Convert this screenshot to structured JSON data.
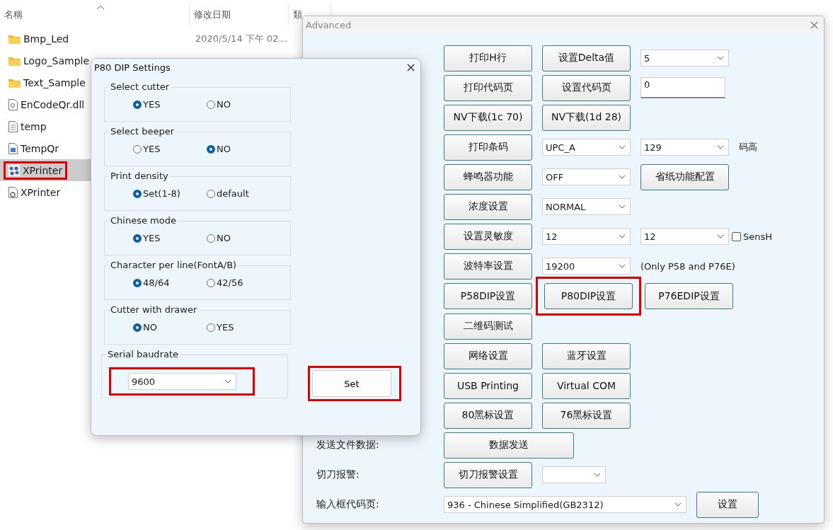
{
  "explorer": {
    "columns": [
      {
        "label": "名稱",
        "sorted": true
      },
      {
        "label": "修改日期",
        "sorted": false
      },
      {
        "label": "類",
        "sorted": false
      }
    ],
    "rows": [
      {
        "name": "Bmp_Led",
        "kind": "folder",
        "date": "2020/5/14 下午 02...",
        "selected": false,
        "highlighted": false
      },
      {
        "name": "Logo_Sample",
        "kind": "folder",
        "selected": false,
        "highlighted": false
      },
      {
        "name": "Text_Sample",
        "kind": "folder",
        "selected": false,
        "highlighted": false
      },
      {
        "name": "EnCodeQr.dll",
        "kind": "library",
        "selected": false,
        "highlighted": false
      },
      {
        "name": "temp",
        "kind": "text",
        "selected": false,
        "highlighted": false
      },
      {
        "name": "TempQr",
        "kind": "image",
        "selected": false,
        "highlighted": false
      },
      {
        "name": "XPrinter",
        "kind": "app",
        "selected": true,
        "highlighted": true
      },
      {
        "name": "XPrinter",
        "kind": "config",
        "selected": false,
        "highlighted": false
      }
    ]
  },
  "advanced": {
    "title": "Advanced",
    "rows": [
      {
        "cells": [
          {
            "kind": "button",
            "text": "打印H行"
          },
          {
            "kind": "button",
            "text": "设置Delta值"
          },
          {
            "kind": "select",
            "text": "5"
          }
        ]
      },
      {
        "cells": [
          {
            "kind": "button",
            "text": "打印代码页"
          },
          {
            "kind": "button",
            "text": "设置代码页"
          },
          {
            "kind": "input",
            "text": "0"
          }
        ]
      },
      {
        "cells": [
          {
            "kind": "button",
            "text": "NV下载(1c 70)"
          },
          {
            "kind": "button",
            "text": "NV下载(1d 28)"
          }
        ]
      },
      {
        "cells": [
          {
            "kind": "button",
            "text": "打印条码"
          },
          {
            "kind": "select",
            "text": "UPC_A"
          },
          {
            "kind": "select",
            "text": "129"
          },
          {
            "kind": "text",
            "text": "码高"
          }
        ]
      },
      {
        "cells": [
          {
            "kind": "button",
            "text": "蜂鸣器功能"
          },
          {
            "kind": "select",
            "text": "OFF"
          },
          {
            "kind": "button",
            "text": "省纸功能配置"
          }
        ]
      },
      {
        "cells": [
          {
            "kind": "button",
            "text": "浓度设置"
          },
          {
            "kind": "select",
            "text": "NORMAL"
          }
        ]
      },
      {
        "cells": [
          {
            "kind": "button",
            "text": "设置灵敏度"
          },
          {
            "kind": "select",
            "text": "12"
          },
          {
            "kind": "select",
            "text": "12"
          },
          {
            "kind": "checkbox",
            "text": "SensH",
            "checked": false
          }
        ]
      },
      {
        "cells": [
          {
            "kind": "button",
            "text": "波特率设置"
          },
          {
            "kind": "select",
            "text": "19200"
          },
          {
            "kind": "text",
            "text": "(Only P58 and P76E)"
          }
        ]
      },
      {
        "cells": [
          {
            "kind": "button",
            "text": "P58DIP设置"
          },
          {
            "kind": "button",
            "text": "P80DIP设置",
            "highlighted": true
          },
          {
            "kind": "button",
            "text": "P76EDIP设置"
          }
        ]
      },
      {
        "cells": [
          {
            "kind": "button",
            "text": "二维码测试"
          }
        ]
      },
      {
        "cells": [
          {
            "kind": "button",
            "text": "网络设置"
          },
          {
            "kind": "button",
            "text": "蓝牙设置"
          }
        ]
      },
      {
        "cells": [
          {
            "kind": "button",
            "text": "USB Printing"
          },
          {
            "kind": "button",
            "text": "Virtual COM"
          }
        ]
      },
      {
        "cells": [
          {
            "kind": "button",
            "text": "80黑标设置"
          },
          {
            "kind": "button",
            "text": "76黑标设置"
          }
        ]
      },
      {
        "label": "发送文件数据:",
        "cells": [
          {
            "kind": "wide_button",
            "text": "数据发送"
          }
        ]
      },
      {
        "label": "切刀报警:",
        "cells": [
          {
            "kind": "button",
            "text": "切刀报警设置"
          },
          {
            "kind": "small_select"
          }
        ]
      },
      {
        "label": "输入框代码页:",
        "cells": [
          {
            "kind": "wide_select",
            "text": "936 - Chinese Simplified(GB2312)"
          },
          {
            "kind": "short_button",
            "text": "设置"
          }
        ]
      }
    ]
  },
  "dip": {
    "title": "P80 DIP Settings",
    "groups": [
      {
        "title": "Select cutter",
        "options": [
          {
            "label": "YES",
            "selected": true
          },
          {
            "label": "NO",
            "selected": false
          }
        ]
      },
      {
        "title": "Select beeper",
        "options": [
          {
            "label": "YES",
            "selected": false
          },
          {
            "label": "NO",
            "selected": true
          }
        ]
      },
      {
        "title": "Print density",
        "options": [
          {
            "label": "Set(1-8)",
            "selected": true
          },
          {
            "label": "default",
            "selected": false
          }
        ]
      },
      {
        "title": "Chinese mode",
        "options": [
          {
            "label": "YES",
            "selected": true
          },
          {
            "label": "NO",
            "selected": false
          }
        ]
      },
      {
        "title": "Character per line(FontA/B)",
        "options": [
          {
            "label": "48/64",
            "selected": true
          },
          {
            "label": "42/56",
            "selected": false
          }
        ]
      },
      {
        "title": "Cutter with drawer",
        "options": [
          {
            "label": "NO",
            "selected": true
          },
          {
            "label": "YES",
            "selected": false
          }
        ]
      }
    ],
    "baud": {
      "title": "Serial baudrate",
      "value": "9600",
      "highlighted": true
    },
    "set_button": {
      "label": "Set",
      "highlighted": true
    }
  }
}
